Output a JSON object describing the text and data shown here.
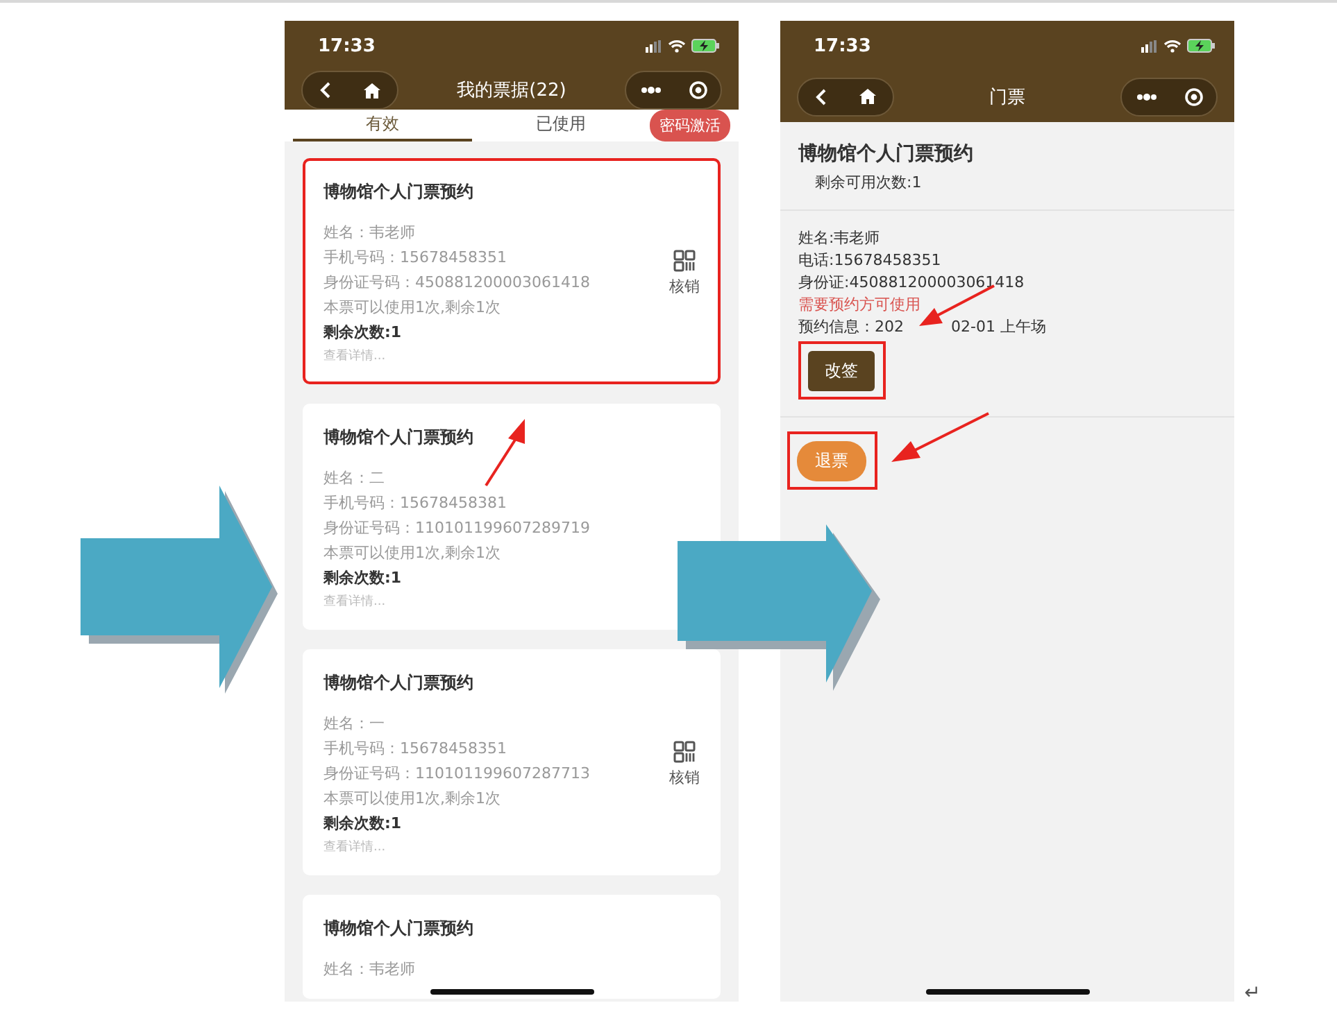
{
  "left_phone": {
    "status_bar": {
      "time": "17:33"
    },
    "nav": {
      "title": "我的票据(22)"
    },
    "tabs": [
      {
        "label": "有效",
        "selected": true
      },
      {
        "label": "已使用",
        "selected": false
      }
    ],
    "action_button": "密码激活",
    "tickets": [
      {
        "title": "博物馆个人门票预约",
        "name": "姓名：韦老师",
        "phone": "手机号码：15678458351",
        "id": "身份证号码：450881200003061418",
        "usage": "本票可以使用1次,剩余1次",
        "remaining": "剩余次数:1",
        "details": "查看详情...",
        "verify_label": "核销",
        "highlighted": true
      },
      {
        "title": "博物馆个人门票预约",
        "name": "姓名：二",
        "phone": "手机号码：15678458381",
        "id": "身份证号码：110101199607289719",
        "usage": "本票可以使用1次,剩余1次",
        "remaining": "剩余次数:1",
        "details": "查看详情...",
        "highlighted": false
      },
      {
        "title": "博物馆个人门票预约",
        "name": "姓名：一",
        "phone": "手机号码：15678458351",
        "id": "身份证号码：110101199607287713",
        "usage": "本票可以使用1次,剩余1次",
        "remaining": "剩余次数:1",
        "details": "查看详情...",
        "verify_label": "核销",
        "highlighted": false
      },
      {
        "title": "博物馆个人门票预约",
        "name": "姓名：韦老师",
        "highlighted": false
      }
    ]
  },
  "right_phone": {
    "status_bar": {
      "time": "17:33"
    },
    "nav": {
      "title": "门票"
    },
    "ticket": {
      "title": "博物馆个人门票预约",
      "remaining": "剩余可用次数:1"
    },
    "info": [
      {
        "text": "姓名:韦老师",
        "kind": "plain"
      },
      {
        "text": "电话:15678458351",
        "kind": "plain"
      },
      {
        "text": "身份证:450881200003061418",
        "kind": "plain"
      },
      {
        "text": "需要预约方可使用",
        "kind": "warning"
      }
    ],
    "booking": [
      "预约信息：202",
      "02-01 上午场"
    ],
    "buttons": [
      {
        "label": "改签",
        "kind": "dark",
        "highlighted": true
      },
      {
        "label": "退票",
        "kind": "orange",
        "highlighted": true
      }
    ]
  },
  "paragraph_mark": "↵"
}
